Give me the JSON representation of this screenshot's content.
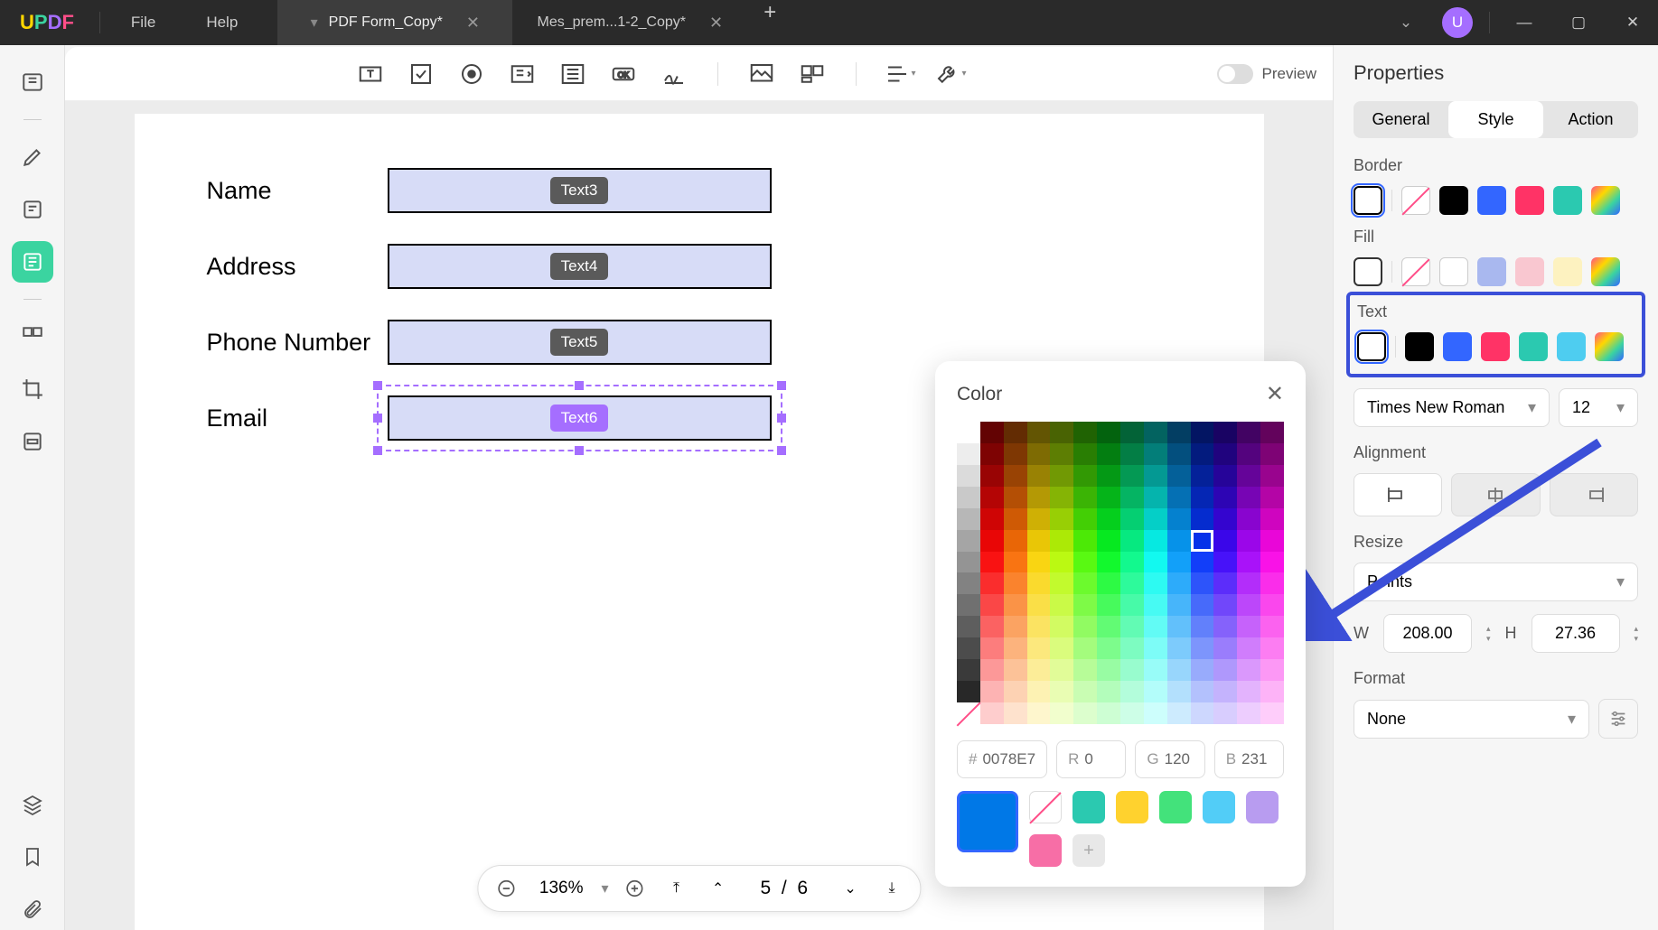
{
  "titlebar": {
    "menus": {
      "file": "File",
      "help": "Help"
    },
    "tabs": [
      {
        "title": "PDF Form_Copy*",
        "active": true
      },
      {
        "title": "Mes_prem...1-2_Copy*",
        "active": false
      }
    ],
    "avatar_letter": "U"
  },
  "toolbar": {
    "preview_label": "Preview"
  },
  "form": {
    "rows": [
      {
        "label": "Name",
        "badge": "Text3"
      },
      {
        "label": "Address",
        "badge": "Text4"
      },
      {
        "label": "Phone Number",
        "badge": "Text5"
      },
      {
        "label": "Email",
        "badge": "Text6",
        "selected": true
      }
    ]
  },
  "bottom": {
    "zoom": "136%",
    "page_current": "5",
    "page_total": "6"
  },
  "color_popup": {
    "title": "Color",
    "hex_label": "#",
    "hex_value": "0078E7",
    "r_label": "R",
    "r_value": "0",
    "g_label": "G",
    "g_value": "120",
    "b_label": "B",
    "b_value": "231",
    "presets": [
      "#2bc9b0",
      "#ffd22e",
      "#43e27b",
      "#52cdf7",
      "#b89cf0",
      "#f76ea6"
    ]
  },
  "properties": {
    "title": "Properties",
    "tabs": {
      "general": "General",
      "style": "Style",
      "action": "Action"
    },
    "border_label": "Border",
    "fill_label": "Fill",
    "text_label": "Text",
    "font_name": "Times New Roman",
    "font_size": "12",
    "alignment_label": "Alignment",
    "resize_label": "Resize",
    "resize_unit": "Points",
    "w_label": "W",
    "w_value": "208.00",
    "h_label": "H",
    "h_value": "27.36",
    "format_label": "Format",
    "format_value": "None",
    "border_swatches": [
      "#000000",
      "#3366ff",
      "#ff3366",
      "#2bc9b0"
    ],
    "fill_swatches": [
      "#ffffff",
      "#a9b8ef",
      "#f9c7d0",
      "#fdf2c0"
    ],
    "text_swatches": [
      "#000000",
      "#3366ff",
      "#ff3366",
      "#2bc9b0",
      "#4ecdf0"
    ]
  }
}
